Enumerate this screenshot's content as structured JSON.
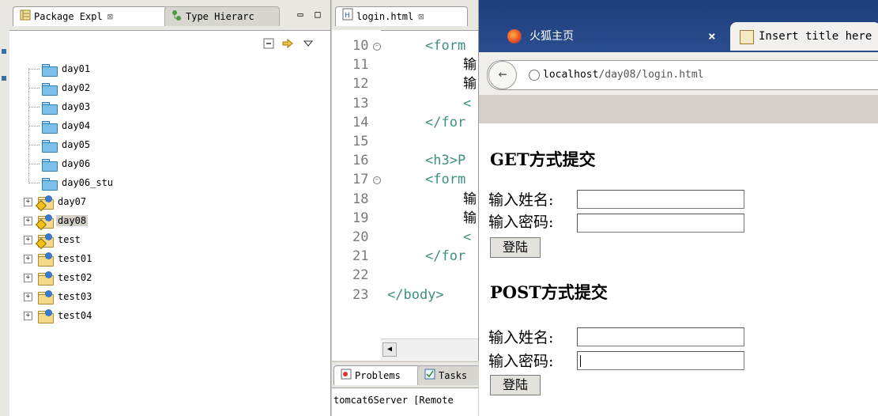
{
  "eclipse": {
    "package_explorer": {
      "tab_label": "Package Expl",
      "tab_close": "⊠",
      "other_tab_label": "Type Hierarc",
      "view_min": "▭",
      "view_max": "□",
      "tree": [
        {
          "label": "day01",
          "type": "folder"
        },
        {
          "label": "day02",
          "type": "folder"
        },
        {
          "label": "day03",
          "type": "folder"
        },
        {
          "label": "day04",
          "type": "folder"
        },
        {
          "label": "day05",
          "type": "folder"
        },
        {
          "label": "day06",
          "type": "folder"
        },
        {
          "label": "day06_stu",
          "type": "folder"
        },
        {
          "label": "day07",
          "type": "project",
          "warning": true
        },
        {
          "label": "day08",
          "type": "project",
          "warning": true,
          "selected": true
        },
        {
          "label": "test",
          "type": "project",
          "warning": true
        },
        {
          "label": "test01",
          "type": "project"
        },
        {
          "label": "test02",
          "type": "project"
        },
        {
          "label": "test03",
          "type": "project"
        },
        {
          "label": "test04",
          "type": "project"
        }
      ]
    },
    "editor": {
      "tab_label": "login.html",
      "tab_close": "⊠",
      "lines": [
        {
          "num": "10",
          "fold": true,
          "code": "<form",
          "kind": "tag",
          "indent": 1
        },
        {
          "num": "11",
          "code": "输",
          "kind": "txt",
          "indent": 2
        },
        {
          "num": "12",
          "code": "输",
          "kind": "txt",
          "indent": 2
        },
        {
          "num": "13",
          "code": "<",
          "kind": "tag",
          "indent": 2
        },
        {
          "num": "14",
          "code": "</for",
          "kind": "tag",
          "indent": 1
        },
        {
          "num": "15",
          "code": "",
          "kind": "txt",
          "indent": 1
        },
        {
          "num": "16",
          "code": "<h3>P",
          "kind": "tag",
          "indent": 1
        },
        {
          "num": "17",
          "fold": true,
          "code": "<form",
          "kind": "tag",
          "indent": 1
        },
        {
          "num": "18",
          "code": "输",
          "kind": "txt",
          "indent": 2
        },
        {
          "num": "19",
          "code": "输",
          "kind": "txt",
          "indent": 2
        },
        {
          "num": "20",
          "code": "<",
          "kind": "tag",
          "indent": 2
        },
        {
          "num": "21",
          "code": "</for",
          "kind": "tag",
          "indent": 1
        },
        {
          "num": "22",
          "code": "",
          "kind": "txt",
          "indent": 1
        },
        {
          "num": "23",
          "code": "</body>",
          "kind": "tag",
          "indent": 0
        }
      ]
    },
    "problems": {
      "tab1": "Problems",
      "tab2": "Tasks",
      "console_line": "tomcat6Server [Remote"
    }
  },
  "firefox": {
    "tab1_label": "火狐主页",
    "tab1_close": "×",
    "tab2_label": "Insert title here",
    "url_host": "localhost",
    "url_path": "/day08/login.html",
    "page": {
      "get_title": "GET方式提交",
      "post_title": "POST方式提交",
      "name_label": "输入姓名:",
      "password_label": "输入密码:",
      "submit_label": "登陆"
    }
  },
  "colors": {
    "tag": "#3f8f7f",
    "line_number": "#7a7a7a",
    "firefox_chrome": "#1f3e7a"
  }
}
